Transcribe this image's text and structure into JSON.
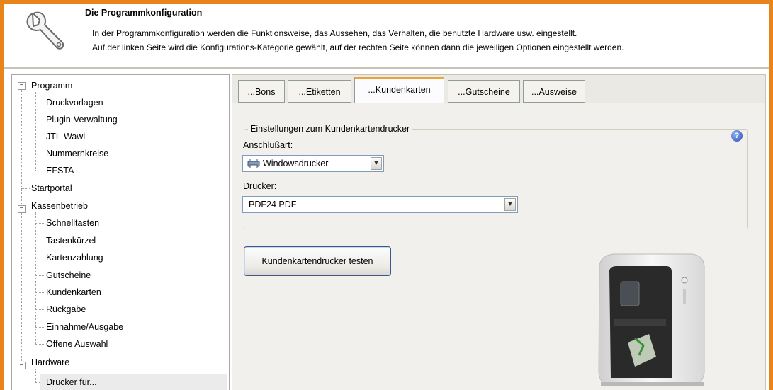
{
  "header": {
    "title": "Die Programmkonfiguration",
    "line1": "In der Programmkonfiguration werden die Funktionsweise, das Aussehen, das Verhalten, die benutzte Hardware usw. eingestellt.",
    "line2": "Auf der linken Seite wird die Konfigurations-Kategorie gewählt, auf der rechten Seite können dann die jeweiligen Optionen eingestellt werden.",
    "icon": "wrench-icon"
  },
  "tree": {
    "programm": "Programm",
    "druckvorlagen": "Druckvorlagen",
    "plugin": "Plugin-Verwaltung",
    "jtl": "JTL-Wawi",
    "nummernkreise": "Nummernkreise",
    "efsta": "EFSTA",
    "startportal": "Startportal",
    "kassenbetrieb": "Kassenbetrieb",
    "schnelltasten": "Schnelltasten",
    "tastenkuerzel": "Tastenkürzel",
    "kartenzahlung": "Kartenzahlung",
    "gutscheine": "Gutscheine",
    "kundenkarten": "Kundenkarten",
    "rueckgabe": "Rückgabe",
    "einnahme": "Einnahme/Ausgabe",
    "offene": "Offene Auswahl",
    "hardware": "Hardware",
    "drucker": "Drucker für..."
  },
  "tabs": {
    "bons": "...Bons",
    "etiketten": "...Etiketten",
    "kundenkarten": "...Kundenkarten",
    "gutscheine": "...Gutscheine",
    "ausweise": "...Ausweise",
    "active": "...Kundenkarten"
  },
  "settings": {
    "group_title": "Einstellungen zum Kundenkartendrucker",
    "anschluss_label": "Anschlußart:",
    "anschluss_value": "Windowsdrucker",
    "drucker_label": "Drucker:",
    "drucker_value": "PDF24 PDF",
    "help": "?"
  },
  "actions": {
    "test_button": "Kundenkartendrucker testen"
  },
  "colors": {
    "frame": "#e8841c",
    "active_tab_accent": "#e7a53b",
    "button_border": "#3c5a89"
  }
}
